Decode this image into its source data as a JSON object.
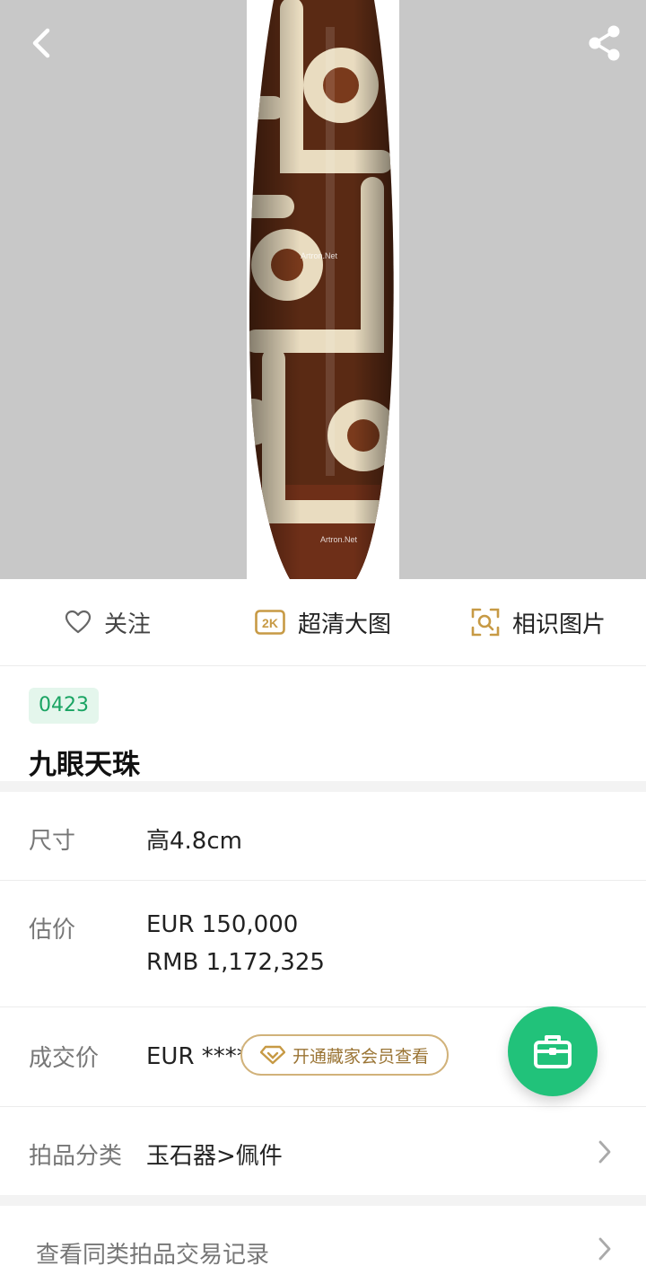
{
  "actions": {
    "follow_label": "关注",
    "hd_label": "超清大图",
    "hd_badge": "2K",
    "similar_label": "相识图片"
  },
  "lot": {
    "number": "0423",
    "title": "九眼天珠"
  },
  "details": {
    "size_label": "尺寸",
    "size_value": "高4.8cm",
    "estimate_label": "估价",
    "estimate_eur": "EUR  150,000",
    "estimate_rmb": "RMB 1,172,325",
    "deal_label": "成交价",
    "deal_value": "EUR ****",
    "vip_button": "开通藏家会员查看",
    "category_label": "拍品分类",
    "category_value": "玉石器>佩件",
    "records_link": "查看同类拍品交易记录"
  },
  "watermark": "Artron.Net",
  "colors": {
    "accent_green": "#21c27a",
    "badge_green": "#1aa463",
    "price_red": "#d63b3b",
    "gold": "#c79a45"
  }
}
